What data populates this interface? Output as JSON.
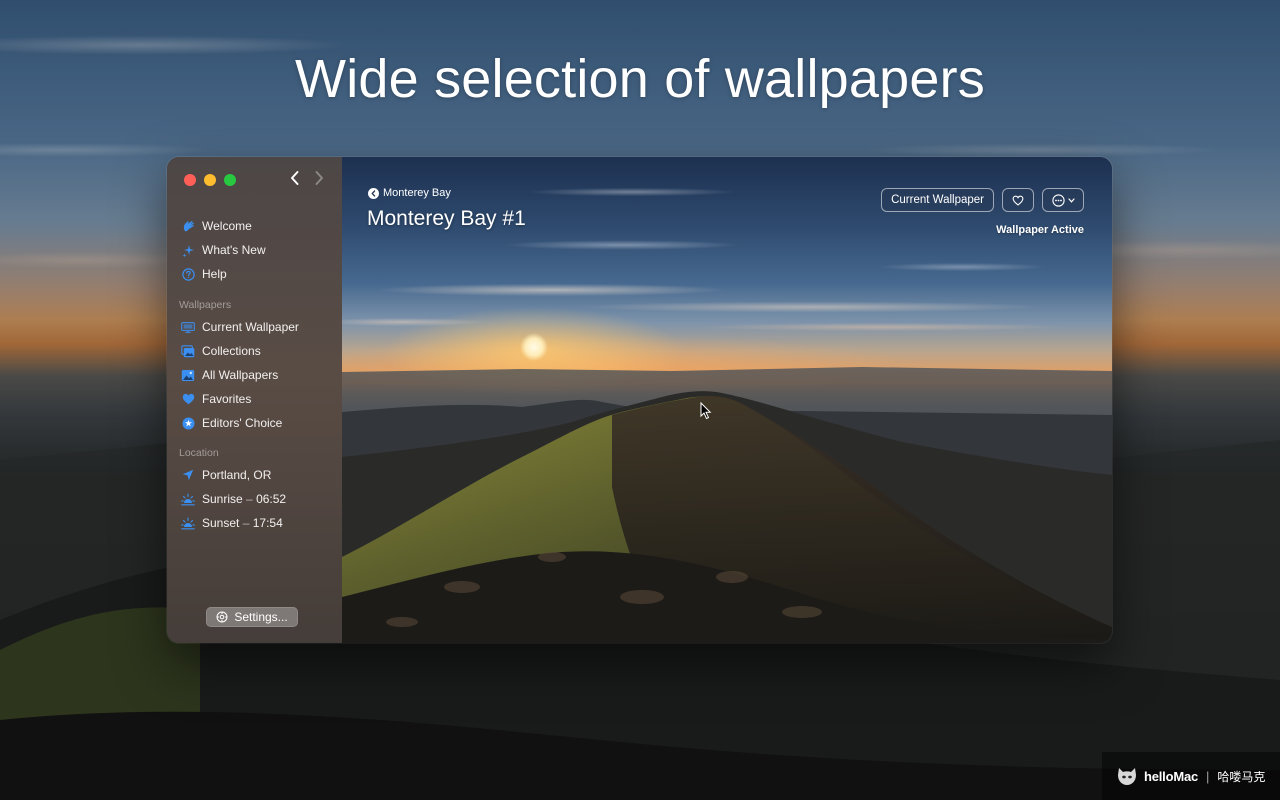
{
  "headline": "Wide selection of wallpapers",
  "window": {
    "nav": {
      "back_icon": "chevron-left-icon",
      "forward_icon": "chevron-right-icon"
    },
    "sidebar": {
      "top_items": [
        {
          "label": "Welcome",
          "icon": "hand-wave-icon"
        },
        {
          "label": "What's New",
          "icon": "sparkles-icon"
        },
        {
          "label": "Help",
          "icon": "question-circle-icon"
        }
      ],
      "wallpapers_header": "Wallpapers",
      "wallpaper_items": [
        {
          "label": "Current Wallpaper",
          "icon": "display-icon"
        },
        {
          "label": "Collections",
          "icon": "photo-stack-icon"
        },
        {
          "label": "All Wallpapers",
          "icon": "photo-icon"
        },
        {
          "label": "Favorites",
          "icon": "heart-icon"
        },
        {
          "label": "Editors' Choice",
          "icon": "star-badge-icon"
        }
      ],
      "location_header": "Location",
      "location_items": [
        {
          "label": "Portland, OR",
          "icon": "location-arrow-icon"
        },
        {
          "label": "Sunrise",
          "time": "06:52",
          "icon": "sunrise-icon"
        },
        {
          "label": "Sunset",
          "time": "17:54",
          "icon": "sunset-icon"
        }
      ],
      "dash": "–",
      "settings_label": "Settings..."
    },
    "main": {
      "back_label": "Monterey Bay",
      "title": "Monterey Bay #1",
      "current_wallpaper_button": "Current Wallpaper",
      "favorite_icon": "heart-outline-icon",
      "more_icon": "ellipsis-circle-icon",
      "status": "Wallpaper Active"
    }
  },
  "watermark": {
    "brand": "helloMac",
    "separator": "|",
    "chinese": "哈喽马克"
  },
  "colors": {
    "accent_blue": "#3b8ff0",
    "traffic_red": "#ff5f57",
    "traffic_yellow": "#febc2e",
    "traffic_green": "#28c840"
  }
}
